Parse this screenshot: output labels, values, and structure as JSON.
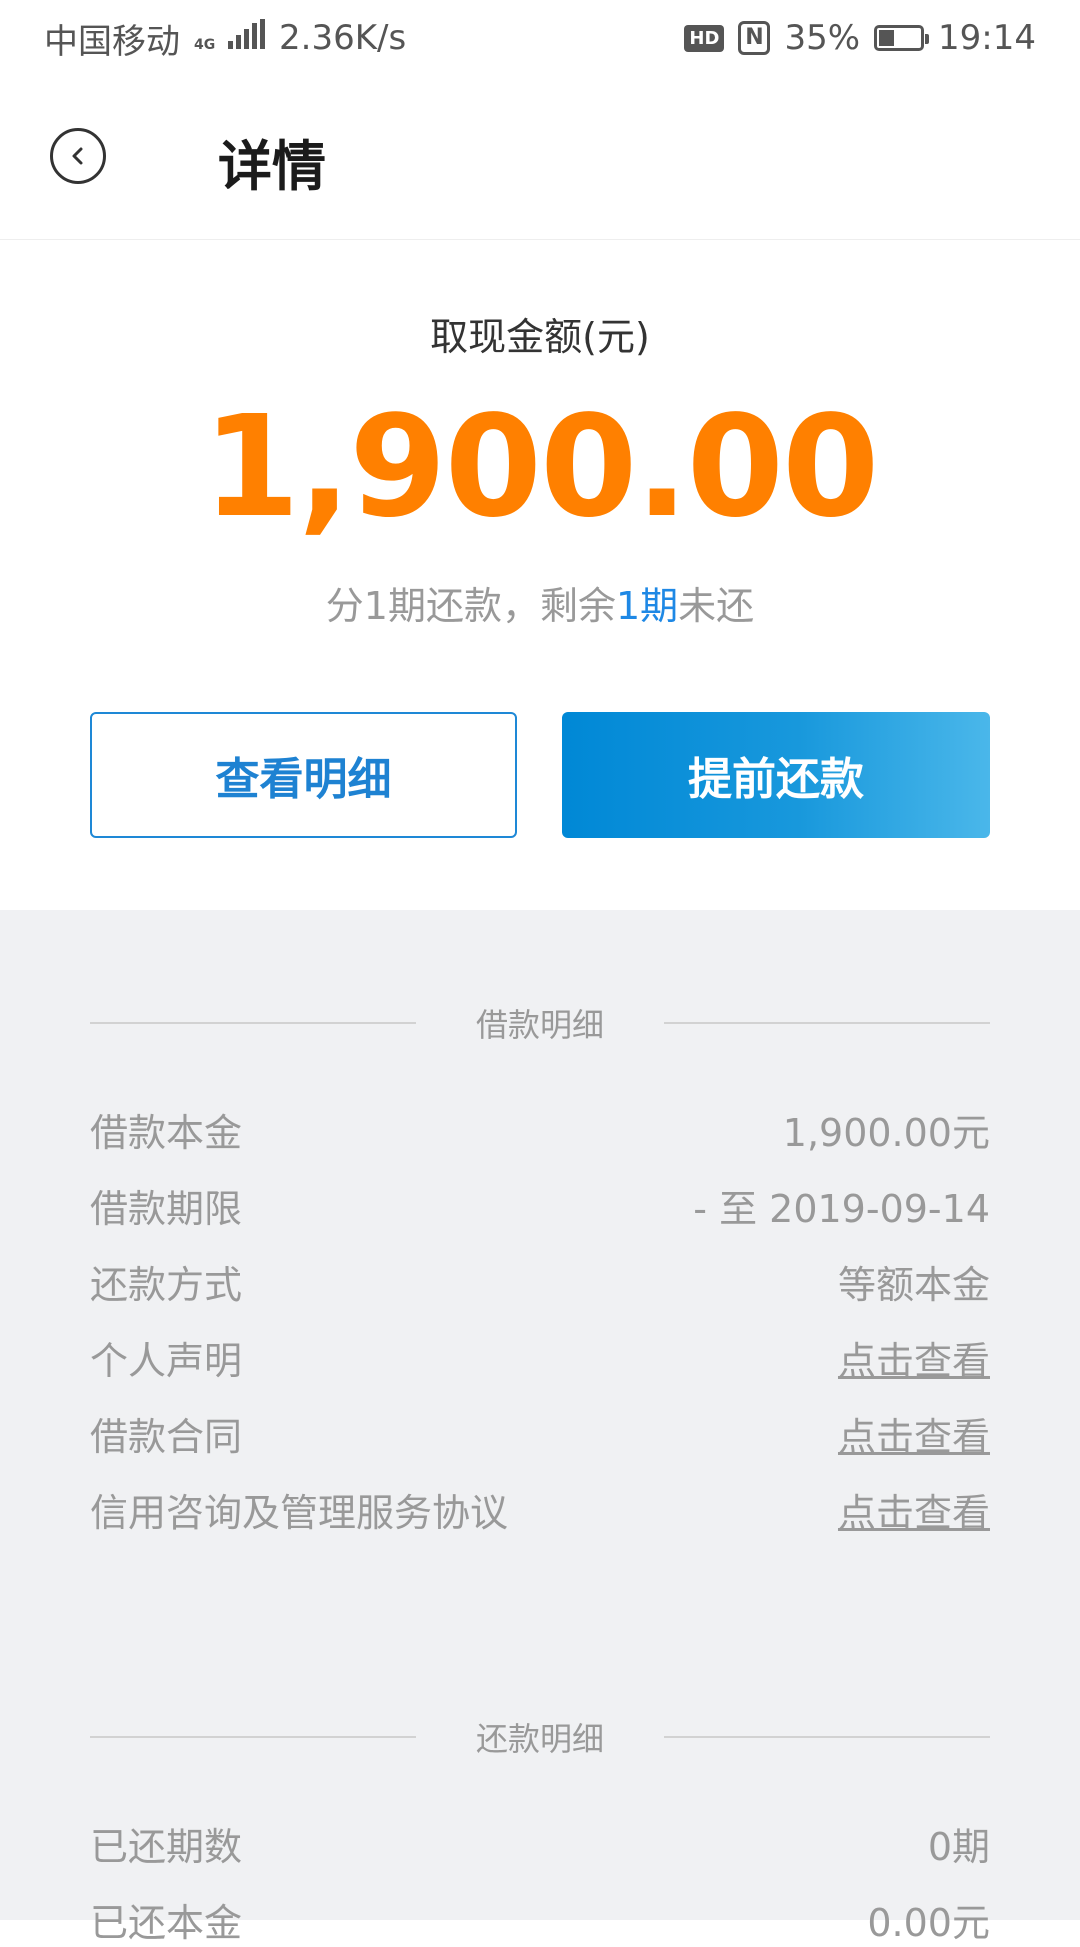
{
  "status_bar": {
    "carrier": "中国移动",
    "network": "4G",
    "speed": "2.36K/s",
    "hd": "HD",
    "nfc": "N",
    "battery": "35%",
    "time": "19:14"
  },
  "header": {
    "title": "详情"
  },
  "summary": {
    "amount_label": "取现金额(元)",
    "amount": "1,900.00",
    "installment_prefix": "分1期还款，剩余",
    "installment_highlight": "1期",
    "installment_suffix": "未还"
  },
  "actions": {
    "detail_label": "查看明细",
    "prepay_label": "提前还款"
  },
  "loan_section": {
    "title": "借款明细",
    "rows": [
      {
        "label": "借款本金",
        "value": "1,900.00元"
      },
      {
        "label": "借款期限",
        "value": "- 至 2019-09-14"
      },
      {
        "label": "还款方式",
        "value": "等额本金"
      },
      {
        "label": "个人声明",
        "value": "点击查看"
      },
      {
        "label": "借款合同",
        "value": "点击查看"
      },
      {
        "label": "信用咨询及管理服务协议",
        "value": "点击查看"
      }
    ]
  },
  "repay_section": {
    "title": "还款明细",
    "rows": [
      {
        "label": "已还期数",
        "value": "0期"
      },
      {
        "label": "已还本金",
        "value": "0.00元"
      }
    ]
  },
  "colors": {
    "amount": "#ff8000",
    "accent": "#1e88e5",
    "background_grey": "#f0f1f3"
  }
}
